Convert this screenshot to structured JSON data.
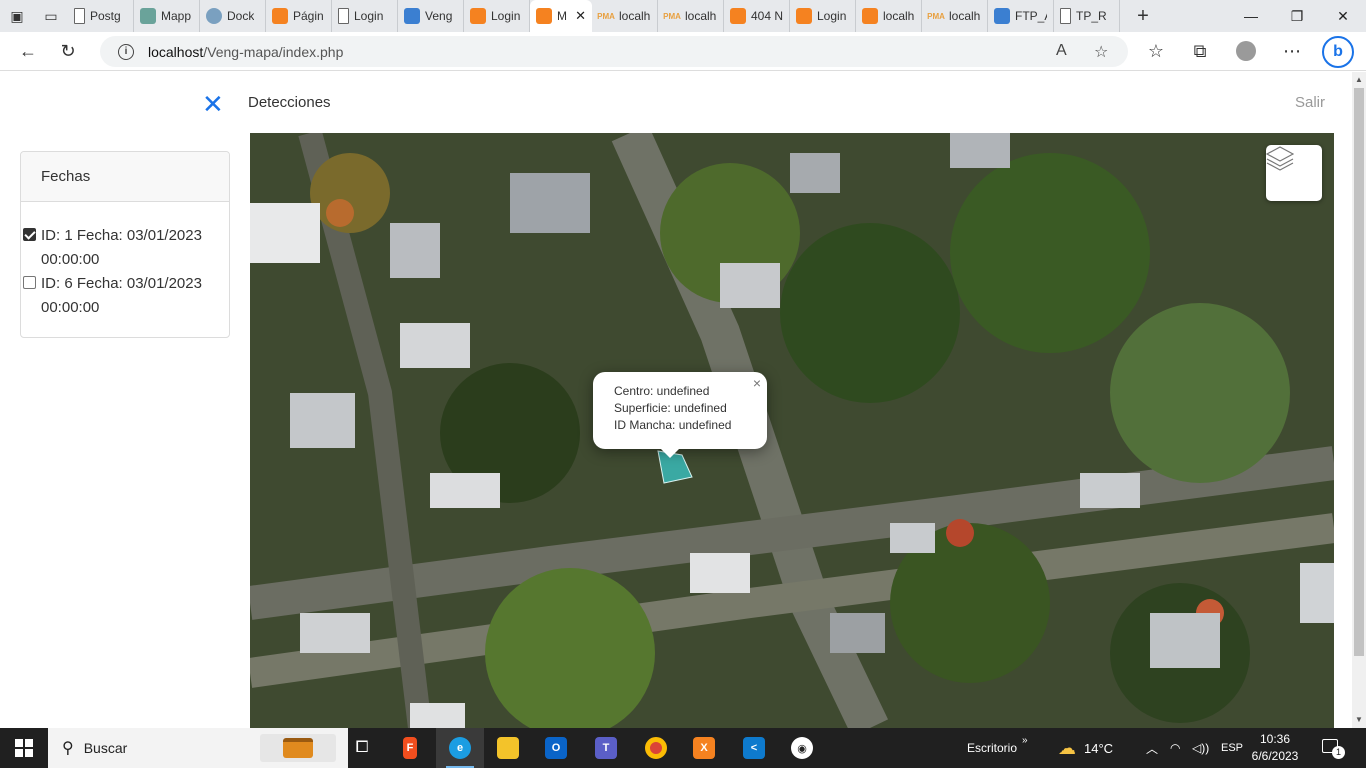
{
  "browser": {
    "tabs": [
      {
        "label": "Postg",
        "icon": "doc"
      },
      {
        "label": "Mapp",
        "icon": "mapg"
      },
      {
        "label": "Dock",
        "icon": "globe"
      },
      {
        "label": "Págin",
        "icon": "xampp"
      },
      {
        "label": "Login",
        "icon": "doc"
      },
      {
        "label": "Veng",
        "icon": "vs"
      },
      {
        "label": "Login",
        "icon": "xampp"
      },
      {
        "label": "M",
        "icon": "xampp",
        "active": true
      },
      {
        "label": "localh",
        "icon": "pma"
      },
      {
        "label": "localh",
        "icon": "pma"
      },
      {
        "label": "404 N",
        "icon": "xampp"
      },
      {
        "label": "Login",
        "icon": "xampp"
      },
      {
        "label": "localh",
        "icon": "xampp"
      },
      {
        "label": "localh",
        "icon": "pma"
      },
      {
        "label": "FTP_A",
        "icon": "vs"
      },
      {
        "label": "TP_R",
        "icon": "doc"
      }
    ],
    "url_host": "localhost",
    "url_path": "/Veng-mapa/index.php"
  },
  "page": {
    "title": "Detecciones",
    "logout_label": "Salir",
    "close_icon": "close-icon",
    "panel": {
      "heading": "Fechas",
      "options": [
        {
          "label": "ID: 1 Fecha: 03/01/2023 00:00:00",
          "checked": true
        },
        {
          "label": "ID: 6 Fecha: 03/01/2023 00:00:00",
          "checked": false
        }
      ]
    },
    "map": {
      "popup": {
        "line1": "Centro: undefined",
        "line2": "Superficie: undefined",
        "line3": "ID Mancha: undefined",
        "close": "×"
      },
      "marker_color": "#3aa9a3"
    }
  },
  "taskbar": {
    "search_label": "Buscar",
    "desktop_label": "Escritorio",
    "temperature": "14°C",
    "language": "ESP",
    "time": "10:36",
    "date": "6/6/2023",
    "notifications": "1"
  }
}
